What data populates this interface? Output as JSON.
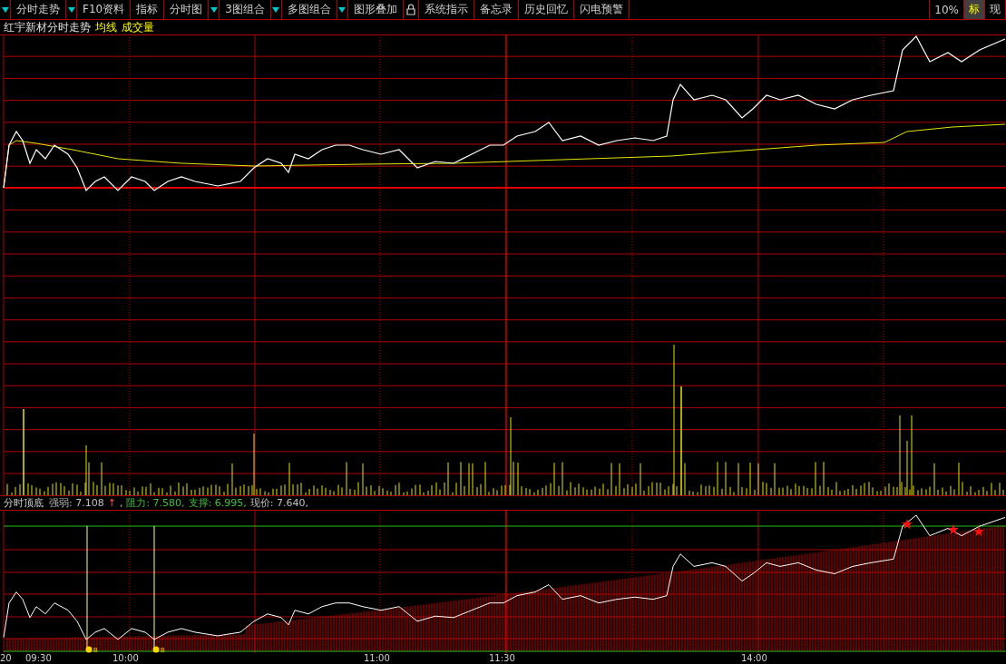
{
  "toolbar": {
    "items": [
      {
        "kind": "dropdown"
      },
      {
        "kind": "menu",
        "label": "分时走势"
      },
      {
        "kind": "dropdown"
      },
      {
        "kind": "menu",
        "label": "F10资料"
      },
      {
        "kind": "menu",
        "label": "指标"
      },
      {
        "kind": "menu",
        "label": "分时图"
      },
      {
        "kind": "dropdown"
      },
      {
        "kind": "menu",
        "label": "3图组合"
      },
      {
        "kind": "dropdown"
      },
      {
        "kind": "menu",
        "label": "多图组合"
      },
      {
        "kind": "dropdown"
      },
      {
        "kind": "menu",
        "label": "图形叠加"
      },
      {
        "kind": "lock"
      },
      {
        "kind": "menu",
        "label": "系统指示"
      },
      {
        "kind": "menu",
        "label": "备忘录"
      },
      {
        "kind": "menu",
        "label": "历史回忆"
      },
      {
        "kind": "menu",
        "label": "闪电预警"
      }
    ],
    "right": [
      {
        "label": "10%",
        "selected": false
      },
      {
        "label": "标",
        "selected": true
      },
      {
        "label": "现",
        "selected": false
      }
    ]
  },
  "chart_title": {
    "name": "红宇新材分时走势",
    "legend": [
      "均线",
      "成交量"
    ]
  },
  "indicator": {
    "name": "分时顶底",
    "parts": [
      {
        "kind": "plain",
        "text": "强弱: 7.108"
      },
      {
        "kind": "arrow",
        "text": "↑"
      },
      {
        "kind": "plain",
        "text": ","
      },
      {
        "kind": "level",
        "text": "阻力: 7.580,"
      },
      {
        "kind": "level",
        "text": "支撑: 6.995,"
      },
      {
        "kind": "plain",
        "text": "现价: 7.640,"
      }
    ],
    "markers": [
      "B",
      "B"
    ]
  },
  "time_axis": [
    "20",
    "09:30",
    "10:00",
    "11:00",
    "11:30",
    "14:00"
  ]
}
